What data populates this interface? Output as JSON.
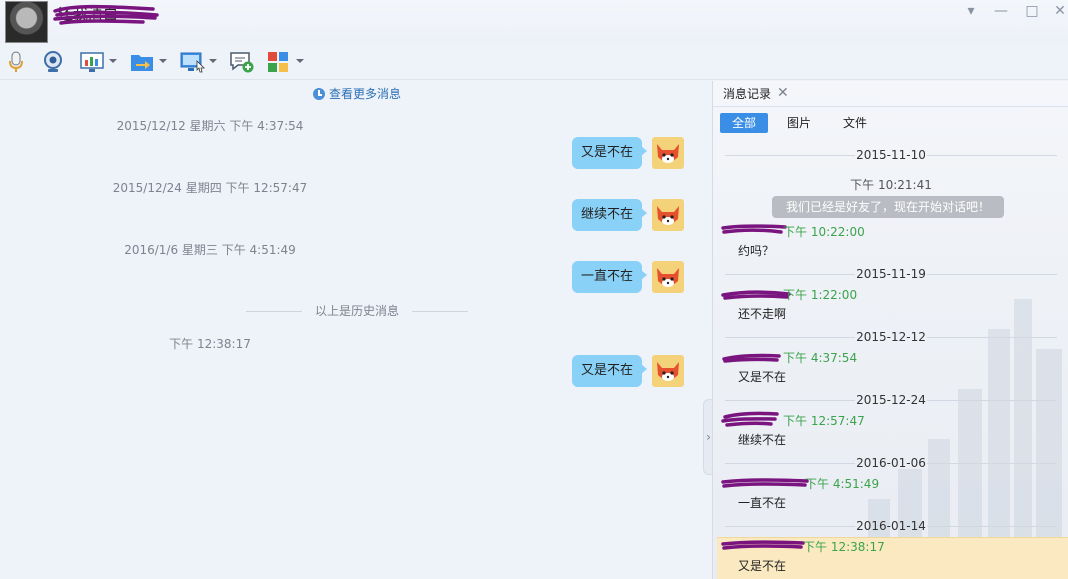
{
  "window": {
    "nickname": "还我清白",
    "menu_label": "▾",
    "minimize_label": "—",
    "maximize_label": "□",
    "close_label": "✕"
  },
  "toolbar": {
    "tools": [
      "microphone-icon",
      "camera-icon",
      "screen-share-icon",
      "file-transfer-icon",
      "remote-desktop-icon",
      "chat-add-icon",
      "apps-icon"
    ]
  },
  "chat": {
    "more_messages": "查看更多消息",
    "history_divider": "以上是历史消息",
    "messages": [
      {
        "timestamp": "2015/12/12 星期六 下午 4:37:54",
        "text": "又是不在"
      },
      {
        "timestamp": "2015/12/24 星期四 下午 12:57:47",
        "text": "继续不在"
      },
      {
        "timestamp": "2016/1/6 星期三 下午 4:51:49",
        "text": "一直不在"
      },
      {
        "timestamp": "下午 12:38:17",
        "text": "又是不在"
      }
    ]
  },
  "panel": {
    "tab_label": "消息记录",
    "tab_close": "✕",
    "filters": [
      "全部",
      "图片",
      "文件"
    ],
    "entries": [
      {
        "date": "2015-11-10",
        "time": "下午 10:21:41",
        "system": "我们已经是好友了，现在开始对话吧！",
        "sender_time": "下午 10:22:00",
        "text": "约吗？"
      },
      {
        "date": "2015-11-19",
        "sender_time": "下午 1:22:00",
        "text": "还不走啊"
      },
      {
        "date": "2015-12-12",
        "sender_time": "下午 4:37:54",
        "text": "又是不在"
      },
      {
        "date": "2015-12-24",
        "sender_time": "下午 12:57:47",
        "text": "继续不在"
      },
      {
        "date": "2016-01-06",
        "sender_time": "下午 4:51:49",
        "text": "一直不在"
      },
      {
        "date": "2016-01-14",
        "sender_time": "下午 12:38:17",
        "text": "又是不在"
      }
    ]
  },
  "colors": {
    "accent": "#3a8ee6",
    "bubble": "#89d1f7",
    "sender_green": "#3aa34b",
    "highlight": "#fbeac1",
    "scribble": "#7a1580"
  }
}
